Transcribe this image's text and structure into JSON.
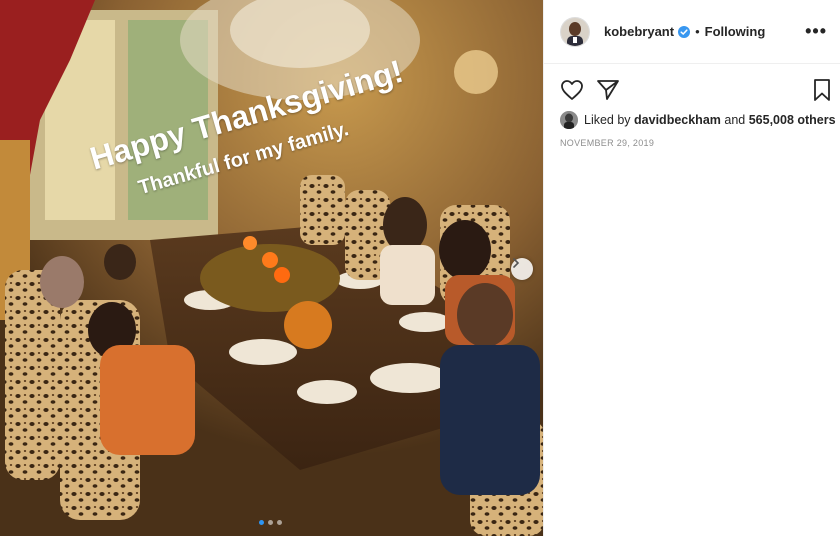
{
  "photo": {
    "overlay_line1": "Happy Thanksgiving!",
    "overlay_line2": "Thankful for my family.",
    "slide_count": 3,
    "active_slide_index": 0
  },
  "post": {
    "username": "kobebryant",
    "verified": true,
    "separator": "•",
    "follow_status": "Following",
    "more_label": "•••",
    "liked_by_prefix": "Liked by",
    "liked_by_user": "davidbeckham",
    "liked_and": "and",
    "liked_others": "565,008 others",
    "date": "NOVEMBER 29, 2019"
  },
  "icons": {
    "like": "heart-icon",
    "share": "paper-plane-icon",
    "save": "bookmark-icon",
    "verified": "verified-badge-icon",
    "next": "chevron-right-icon",
    "more": "more-options-icon"
  },
  "colors": {
    "accent_blue": "#2f96f3",
    "text_primary": "#262626",
    "text_secondary": "#8e8e8e"
  }
}
